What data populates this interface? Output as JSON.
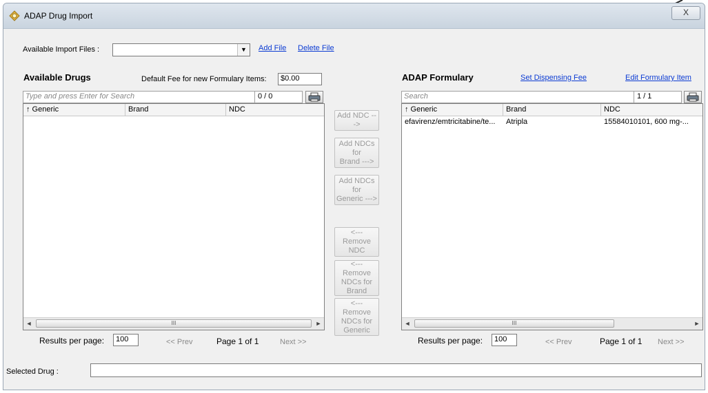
{
  "window": {
    "title": "ADAP Drug Import",
    "close_label": "X"
  },
  "import_files": {
    "label": "Available Import Files :",
    "value": "",
    "add_file": "Add File",
    "delete_file": "Delete File"
  },
  "available_drugs": {
    "title": "Available Drugs",
    "default_fee_label": "Default Fee for new Formulary Items:",
    "default_fee_value": "$0.00",
    "search_placeholder": "Type and press Enter for Search",
    "count": "0 / 0",
    "columns": [
      "↑ Generic",
      "Brand",
      "NDC"
    ],
    "rows": [],
    "results_label": "Results per page:",
    "results_value": "100",
    "prev": "<< Prev",
    "page": "Page 1 of 1",
    "next": "Next >>"
  },
  "formulary": {
    "title": "ADAP Formulary",
    "set_fee": "Set Dispensing Fee",
    "edit_item": "Edit Formulary Item",
    "search_placeholder": "Search",
    "count": "1 / 1",
    "columns": [
      "↑ Generic",
      "Brand",
      "NDC"
    ],
    "rows": [
      {
        "generic": "efavirenz/emtricitabine/te...",
        "brand": "Atripla",
        "ndc": "15584010101, 600 mg-..."
      }
    ],
    "results_label": "Results per page:",
    "results_value": "100",
    "prev": "<< Prev",
    "page": "Page 1 of 1",
    "next": "Next >>"
  },
  "actions": {
    "add_ndc": "Add NDC --->",
    "add_brand": "Add NDCs for\nBrand --->",
    "add_generic": "Add NDCs for\nGeneric --->",
    "remove_ndc": "<--- Remove\nNDC",
    "remove_brand": "<--- Remove\nNDCs for\nBrand",
    "remove_generic": "<--- Remove\nNDCs for\nGeneric"
  },
  "selected_drug": {
    "label": "Selected Drug :",
    "value": ""
  },
  "scroll": {
    "left": "◄",
    "right": "►",
    "grip": "III"
  },
  "icons": {
    "app": "adap-gear-icon",
    "print": "printer-icon",
    "dropdown": "chevron-down-icon",
    "annotation": "arrow-annotation"
  }
}
